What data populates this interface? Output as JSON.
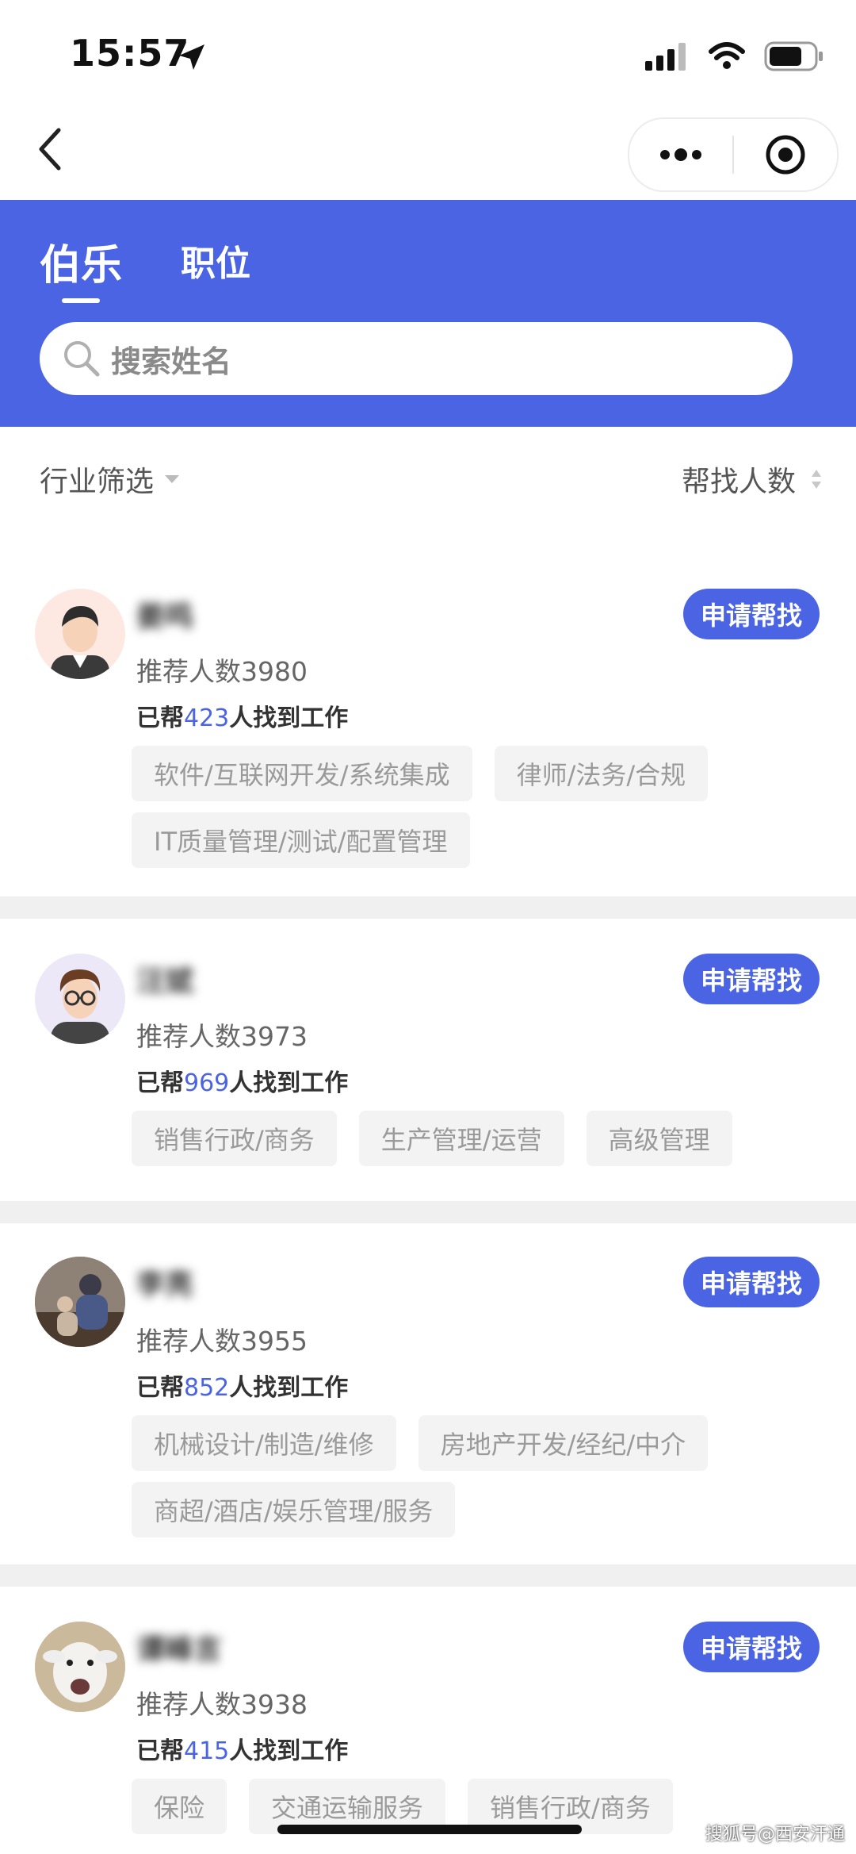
{
  "status_bar": {
    "time": "15:57"
  },
  "tabs": [
    {
      "label": "伯乐"
    },
    {
      "label": "职位"
    }
  ],
  "search": {
    "placeholder": "搜索姓名"
  },
  "filters": {
    "industry": "行业筛选",
    "sort": "帮找人数"
  },
  "apply_label": "申请帮找",
  "helped_prefix": "已帮",
  "helped_suffix": "人找到工作",
  "recruiters": [
    {
      "name": "姜鸣",
      "recommend": "推荐人数3980",
      "helped": "423",
      "tags": [
        "软件/互联网开发/系统集成",
        "律师/法务/合规",
        "IT质量管理/测试/配置管理"
      ]
    },
    {
      "name": "汪斌",
      "recommend": "推荐人数3973",
      "helped": "969",
      "tags": [
        "销售行政/商务",
        "生产管理/运营",
        "高级管理"
      ]
    },
    {
      "name": "李亮",
      "recommend": "推荐人数3955",
      "helped": "852",
      "tags": [
        "机械设计/制造/维修",
        "房地产开发/经纪/中介",
        "商超/酒店/娱乐管理/服务"
      ]
    },
    {
      "name": "谭峰言",
      "recommend": "推荐人数3938",
      "helped": "415",
      "tags": [
        "保险",
        "交通运输服务",
        "销售行政/商务"
      ]
    }
  ],
  "watermark": "搜狐号@西安汗通",
  "colors": {
    "brand_blue": "#4a64e4",
    "tag_bg": "#f3f3f3",
    "page_gap": "#f0f0f0"
  }
}
